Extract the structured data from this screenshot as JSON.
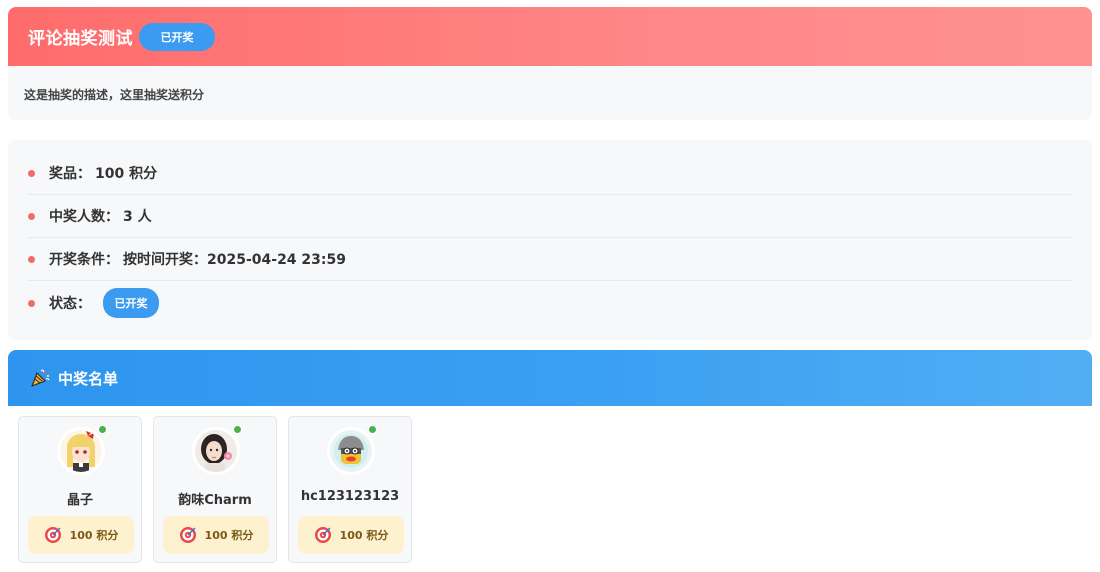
{
  "lottery": {
    "title": "评论抽奖测试",
    "status": "已开奖",
    "description": "这是抽奖的描述，这里抽奖送积分"
  },
  "info": {
    "prize_label": "奖品：",
    "prize_value": "100 积分",
    "winners_count_label": "中奖人数：",
    "winners_count_value": "3 人",
    "condition_label": "开奖条件：",
    "condition_value": "按时间开奖：2025-04-24 23:59",
    "status_label": "状态：",
    "status_value": "已开奖"
  },
  "winners_section": {
    "icon": "party-popper-icon",
    "title": "中奖名单"
  },
  "winners": [
    {
      "name": "晶子",
      "prize": "100 积分",
      "online": true
    },
    {
      "name": "韵味Charm",
      "prize": "100 积分",
      "online": true
    },
    {
      "name": "hc123123123",
      "prize": "100 积分",
      "online": true
    }
  ],
  "colors": {
    "header_gradient_start": "#ff6b6b",
    "header_gradient_end": "#ff9191",
    "accent_blue": "#3b9bf0",
    "bullet_red": "#f26b6b",
    "online_green": "#4caf50",
    "prize_bg": "#fdf1cf"
  }
}
